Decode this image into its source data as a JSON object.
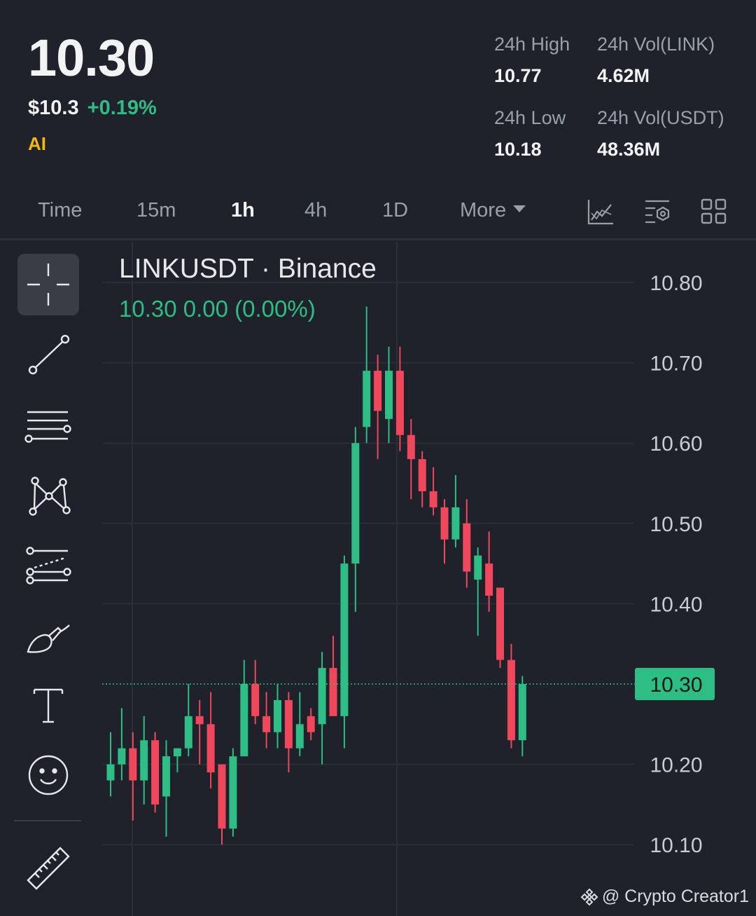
{
  "header": {
    "last_price": "10.30",
    "usd_price": "$10.3",
    "change_pct": "+0.19%",
    "ai_label": "AI"
  },
  "stats": [
    {
      "label": "24h High",
      "value": "10.77"
    },
    {
      "label": "24h Vol(LINK)",
      "value": "4.62M"
    },
    {
      "label": "24h Low",
      "value": "10.18"
    },
    {
      "label": "24h Vol(USDT)",
      "value": "48.36M"
    }
  ],
  "tabs": {
    "time": "Time",
    "m15": "15m",
    "h1": "1h",
    "h4": "4h",
    "d1": "1D",
    "more": "More",
    "active": "1h"
  },
  "toolbar_icons": [
    "indicator-chart-icon",
    "chart-settings-icon",
    "layout-grid-icon"
  ],
  "sidebar_tools": [
    "crosshair-icon",
    "trend-line-icon",
    "horizontal-lines-icon",
    "pattern-icon",
    "fib-channel-icon",
    "brush-icon",
    "text-icon",
    "emoji-icon",
    "ruler-icon"
  ],
  "chart": {
    "symbol_line": "LINKUSDT · Binance",
    "ohlc_line": "10.30  0.00 (0.00%)",
    "current_price_label": "10.30"
  },
  "colors": {
    "up": "#2ebd85",
    "down": "#f0475c",
    "background": "#1f222b",
    "accent": "#f0b90b"
  },
  "watermark": "@ Crypto Creator1",
  "chart_data": {
    "type": "candlestick",
    "title": "LINKUSDT · Binance",
    "interval": "1h",
    "y_ticks": [
      "10.80",
      "10.70",
      "10.60",
      "10.50",
      "10.40",
      "10.30",
      "10.20",
      "10.10"
    ],
    "ylim": [
      10.05,
      10.85
    ],
    "current_price": 10.3,
    "grid": true,
    "candles": [
      {
        "o": 10.18,
        "h": 10.24,
        "l": 10.16,
        "c": 10.2
      },
      {
        "o": 10.2,
        "h": 10.27,
        "l": 10.18,
        "c": 10.22
      },
      {
        "o": 10.22,
        "h": 10.24,
        "l": 10.13,
        "c": 10.18
      },
      {
        "o": 10.18,
        "h": 10.26,
        "l": 10.15,
        "c": 10.23
      },
      {
        "o": 10.23,
        "h": 10.24,
        "l": 10.14,
        "c": 10.15
      },
      {
        "o": 10.16,
        "h": 10.23,
        "l": 10.11,
        "c": 10.21
      },
      {
        "o": 10.21,
        "h": 10.22,
        "l": 10.19,
        "c": 10.22
      },
      {
        "o": 10.22,
        "h": 10.3,
        "l": 10.21,
        "c": 10.26
      },
      {
        "o": 10.26,
        "h": 10.28,
        "l": 10.2,
        "c": 10.25
      },
      {
        "o": 10.25,
        "h": 10.29,
        "l": 10.17,
        "c": 10.19
      },
      {
        "o": 10.2,
        "h": 10.2,
        "l": 10.1,
        "c": 10.12
      },
      {
        "o": 10.12,
        "h": 10.22,
        "l": 10.11,
        "c": 10.21
      },
      {
        "o": 10.21,
        "h": 10.33,
        "l": 10.21,
        "c": 10.3
      },
      {
        "o": 10.3,
        "h": 10.33,
        "l": 10.25,
        "c": 10.26
      },
      {
        "o": 10.26,
        "h": 10.29,
        "l": 10.22,
        "c": 10.24
      },
      {
        "o": 10.24,
        "h": 10.3,
        "l": 10.22,
        "c": 10.28
      },
      {
        "o": 10.28,
        "h": 10.29,
        "l": 10.19,
        "c": 10.22
      },
      {
        "o": 10.22,
        "h": 10.29,
        "l": 10.21,
        "c": 10.25
      },
      {
        "o": 10.26,
        "h": 10.27,
        "l": 10.23,
        "c": 10.24
      },
      {
        "o": 10.25,
        "h": 10.34,
        "l": 10.2,
        "c": 10.32
      },
      {
        "o": 10.32,
        "h": 10.36,
        "l": 10.27,
        "c": 10.26
      },
      {
        "o": 10.26,
        "h": 10.46,
        "l": 10.22,
        "c": 10.45
      },
      {
        "o": 10.45,
        "h": 10.62,
        "l": 10.39,
        "c": 10.6
      },
      {
        "o": 10.62,
        "h": 10.77,
        "l": 10.6,
        "c": 10.69
      },
      {
        "o": 10.69,
        "h": 10.71,
        "l": 10.58,
        "c": 10.64
      },
      {
        "o": 10.63,
        "h": 10.72,
        "l": 10.6,
        "c": 10.69
      },
      {
        "o": 10.69,
        "h": 10.72,
        "l": 10.59,
        "c": 10.61
      },
      {
        "o": 10.61,
        "h": 10.63,
        "l": 10.53,
        "c": 10.58
      },
      {
        "o": 10.58,
        "h": 10.59,
        "l": 10.52,
        "c": 10.54
      },
      {
        "o": 10.54,
        "h": 10.57,
        "l": 10.51,
        "c": 10.52
      },
      {
        "o": 10.52,
        "h": 10.53,
        "l": 10.45,
        "c": 10.48
      },
      {
        "o": 10.48,
        "h": 10.56,
        "l": 10.47,
        "c": 10.52
      },
      {
        "o": 10.5,
        "h": 10.53,
        "l": 10.42,
        "c": 10.44
      },
      {
        "o": 10.43,
        "h": 10.47,
        "l": 10.36,
        "c": 10.46
      },
      {
        "o": 10.45,
        "h": 10.49,
        "l": 10.39,
        "c": 10.41
      },
      {
        "o": 10.42,
        "h": 10.42,
        "l": 10.32,
        "c": 10.33
      },
      {
        "o": 10.33,
        "h": 10.35,
        "l": 10.22,
        "c": 10.23
      },
      {
        "o": 10.23,
        "h": 10.31,
        "l": 10.21,
        "c": 10.3
      }
    ]
  }
}
